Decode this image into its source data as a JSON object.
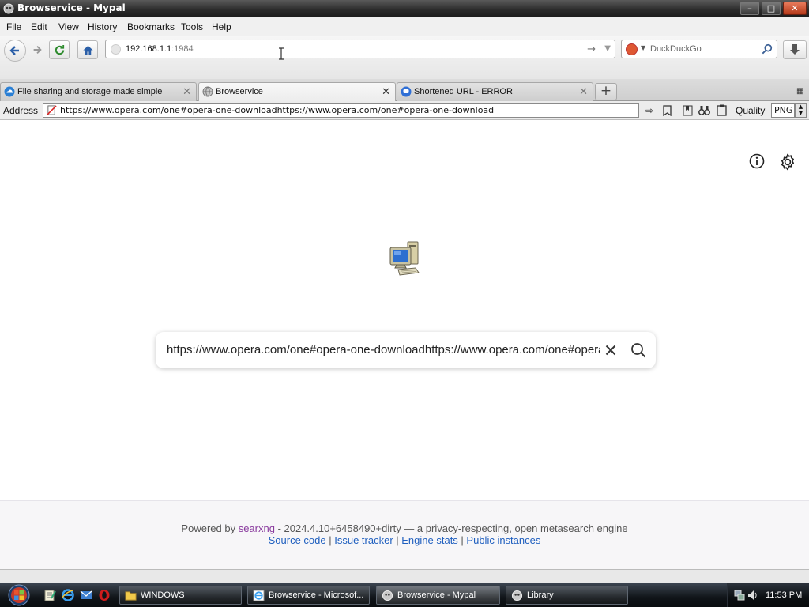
{
  "window": {
    "title": "Browservice - Mypal"
  },
  "menu": {
    "items": [
      "File",
      "Edit",
      "View",
      "History",
      "Bookmarks",
      "Tools",
      "Help"
    ]
  },
  "nav": {
    "url_host": "192.168.1.1",
    "url_port": ":1984",
    "search_placeholder": "DuckDuckGo",
    "search_engine_icon": "duckduckgo-icon"
  },
  "tabs": [
    {
      "label": "File sharing and storage made simple",
      "icon": "cloud-icon",
      "active": false
    },
    {
      "label": "Browservice",
      "icon": "globe-icon",
      "active": true
    },
    {
      "label": "Shortened URL - ERROR",
      "icon": "chat-icon",
      "active": false
    }
  ],
  "address_row": {
    "label": "Address",
    "url": "https://www.opera.com/one#opera-one-downloadhttps://www.opera.com/one#opera-one-download",
    "quality_label": "Quality",
    "format_value": "PNG"
  },
  "page": {
    "search_query": "https://www.opera.com/one#opera-one-downloadhttps://www.opera.com/one#opera-one-download",
    "footer": {
      "powered_by": "Powered by",
      "engine_link": "searxng",
      "version_text": " - 2024.4.10+6458490+dirty — a privacy-respecting, open metasearch engine",
      "source_code": "Source code",
      "issue_tracker": "Issue tracker",
      "engine_stats": "Engine stats",
      "public_instances": "Public instances",
      "sep": " | "
    }
  },
  "taskbar": {
    "tasks": [
      {
        "label": "WINDOWS",
        "icon": "folder-icon",
        "active": false
      },
      {
        "label": "Browservice - Microsof...",
        "icon": "ie-icon",
        "active": false
      },
      {
        "label": "Browservice - Mypal",
        "icon": "mypal-icon",
        "active": true
      },
      {
        "label": "Library",
        "icon": "mypal-icon",
        "active": false
      }
    ],
    "clock": "11:53 PM"
  }
}
